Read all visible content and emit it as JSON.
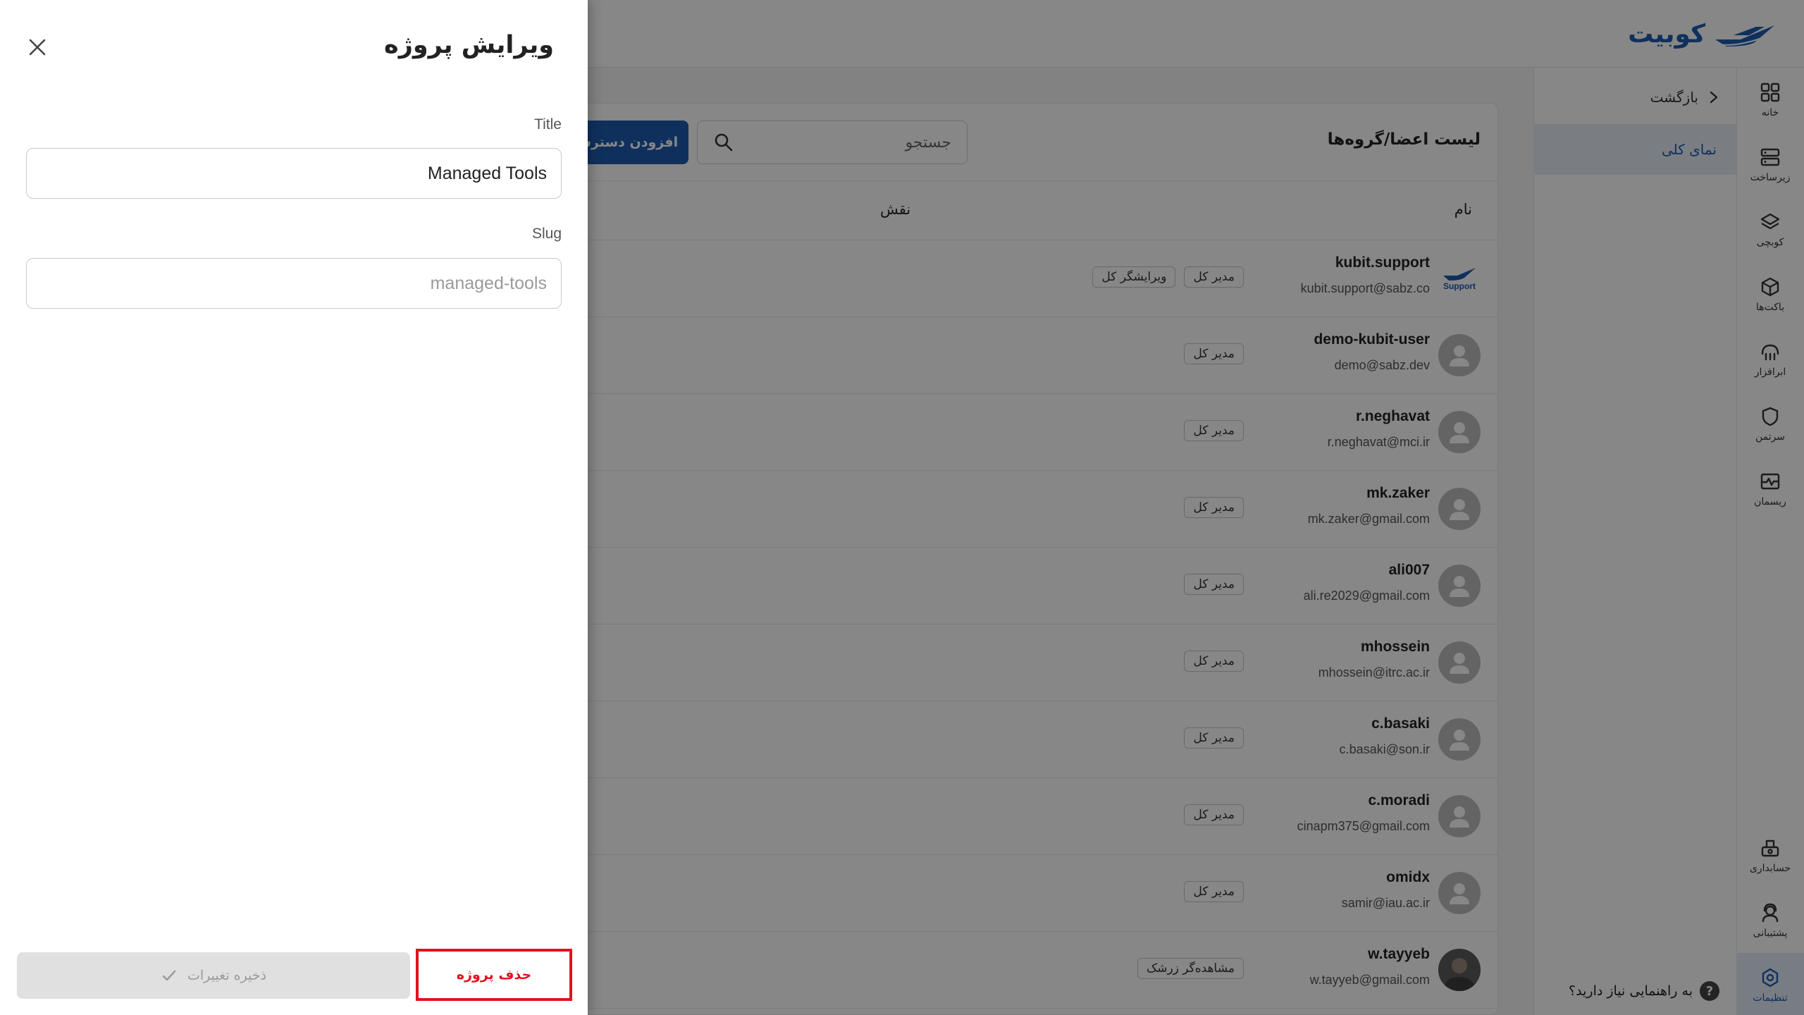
{
  "app": {
    "logo_text": "کوبیت"
  },
  "rail": {
    "items": [
      {
        "label": "خانه",
        "icon": "home-grid-icon"
      },
      {
        "label": "زیرساخت",
        "icon": "server-icon"
      },
      {
        "label": "کوبچی",
        "icon": "layers-icon"
      },
      {
        "label": "باکت‌ها",
        "icon": "box-icon"
      },
      {
        "label": "ابرافزار",
        "icon": "cloud-app-icon"
      },
      {
        "label": "سرتمن",
        "icon": "shield-icon"
      },
      {
        "label": "ریسمان",
        "icon": "chart-window-icon"
      },
      {
        "label": "حسابداری",
        "icon": "accounting-icon"
      },
      {
        "label": "پشتیبانی",
        "icon": "support-icon"
      },
      {
        "label": "تنظیمات",
        "icon": "settings-icon"
      }
    ]
  },
  "subnav": {
    "back_label": "بازگشت",
    "overview_label": "نمای کلی",
    "help_label": "به راهنمایی نیاز دارید؟",
    "help_icon_glyph": "?"
  },
  "members": {
    "title": "لیست اعضا/گروه‌ها",
    "search_placeholder": "جستجو",
    "add_button_label": "افزودن دسترسی",
    "columns": {
      "name": "نام",
      "role": "نقش"
    },
    "support_avatar_text": "Support",
    "rows": [
      {
        "username": "kubit.support",
        "email": "kubit.support@sabz.co",
        "roles": [
          "مدیر کل",
          "ویرایشگر کل"
        ]
      },
      {
        "username": "demo-kubit-user",
        "email": "demo@sabz.dev",
        "roles": [
          "مدیر کل"
        ]
      },
      {
        "username": "r.neghavat",
        "email": "r.neghavat@mci.ir",
        "roles": [
          "مدیر کل"
        ]
      },
      {
        "username": "mk.zaker",
        "email": "mk.zaker@gmail.com",
        "roles": [
          "مدیر کل"
        ]
      },
      {
        "username": "ali007",
        "email": "ali.re2029@gmail.com",
        "roles": [
          "مدیر کل"
        ]
      },
      {
        "username": "mhossein",
        "email": "mhossein@itrc.ac.ir",
        "roles": [
          "مدیر کل"
        ]
      },
      {
        "username": "c.basaki",
        "email": "c.basaki@son.ir",
        "roles": [
          "مدیر کل"
        ]
      },
      {
        "username": "c.moradi",
        "email": "cinapm375@gmail.com",
        "roles": [
          "مدیر کل"
        ]
      },
      {
        "username": "omidx",
        "email": "samir@iau.ac.ir",
        "roles": [
          "مدیر کل"
        ]
      },
      {
        "username": "w.tayyeb",
        "email": "w.tayyeb@gmail.com",
        "roles": [
          "مشاهده‌گر زرشک"
        ]
      }
    ]
  },
  "drawer": {
    "title": "ویرایش پروژه",
    "title_field": {
      "label": "Title",
      "value": "Managed Tools"
    },
    "slug_field": {
      "label": "Slug",
      "value": "managed-tools"
    },
    "save_label": "ذخیره تغییرات",
    "delete_label": "حذف پروژه"
  },
  "colors": {
    "brand": "#1e5bb0",
    "danger": "#e0131f",
    "overlay": "rgba(0,0,0,0.47)"
  }
}
